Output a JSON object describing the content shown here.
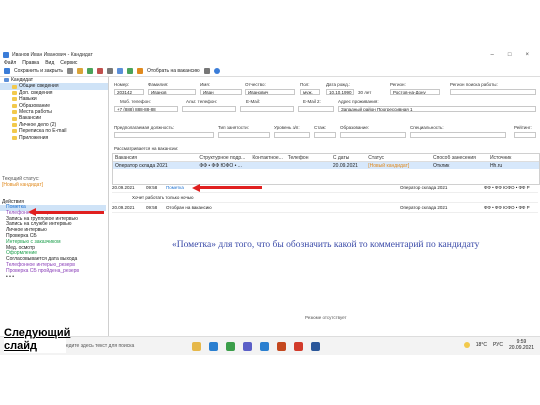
{
  "window": {
    "title": "Иванов Иван Иванович - Кандидат",
    "controls": [
      "–",
      "□",
      "×"
    ]
  },
  "menu": [
    "Файл",
    "Правка",
    "Вид",
    "Сервис"
  ],
  "toolbar": {
    "save_close": "Сохранить и закрыть",
    "send_vacancy": "Отобрать на вакансию"
  },
  "tree": {
    "root": "Кандидат",
    "items": [
      "Общие сведения",
      "Доп. сведения",
      "Навыки",
      "Образование",
      "Места работы",
      "Вакансии",
      "Личное дело (2)",
      "Переписка по E-mail",
      "Приложения"
    ]
  },
  "status": {
    "label": "Текущий статус:",
    "value": "[Новый кандидат]"
  },
  "actions": {
    "label": "Действия",
    "items": [
      {
        "text": "Пометка",
        "color": "#1a6fd0"
      },
      {
        "text": "Телефонное интервью",
        "color": "#8a3fb8"
      },
      {
        "text": "Запись на групповое интервью",
        "color": "#222222"
      },
      {
        "text": "Запись на службе интервью",
        "color": "#222222"
      },
      {
        "text": "Личное интервью",
        "color": "#222222"
      },
      {
        "text": "Проверка СБ",
        "color": "#222222"
      },
      {
        "text": "Интервью с заказчиком",
        "color": "#1a9e4a"
      },
      {
        "text": "Мед. осмотр",
        "color": "#222222"
      },
      {
        "text": "Оформление",
        "color": "#1a9e4a"
      },
      {
        "text": "Согласовывается дата выхода",
        "color": "#222222"
      },
      {
        "text": "Телефонное интерью_резерв",
        "color": "#8a3fb8"
      },
      {
        "text": "Проверка СБ пройдена_резерв",
        "color": "#8a3fb8"
      },
      {
        "text": "• • •",
        "color": "#222222"
      }
    ]
  },
  "source": {
    "method_label": "Способ занесения: Отклик",
    "source_label": "Источник: Hh.ru"
  },
  "form": {
    "number_label": "Номер:",
    "number": "203142",
    "last_label": "Фамилия:",
    "last": "Иванов",
    "first_label": "Имя:",
    "first": "Иван",
    "middle_label": "Отчество:",
    "middle": "Иванович",
    "sex_label": "Пол:",
    "sex": "муж.",
    "dob_label": "Дата рожд.:",
    "dob": "10.10.1990",
    "age": "30 лет",
    "region_label": "Регион:",
    "region": "Ростов-на-Дону",
    "job_region_label": "Регион поиска работы:",
    "mobile_label": "Моб. телефон:",
    "mobile": "+7 (888) 888-88-88",
    "alt_phone_label": "Альт. телефон:",
    "email_label": "E-Mail:",
    "email2_label": "E-Mail 2:",
    "address_label": "Адрес проживания:",
    "address": "Западный район Прогрессивная 1",
    "position_label": "Предполагаемая должность:",
    "employment_label": "Тип занятости:",
    "level_label": "Уровень з/п:",
    "experience_label": "Стаж:",
    "education_label": "Образование:",
    "specialty_label": "Специальность:",
    "rating_label": "Рейтинг:"
  },
  "vacancies": {
    "heading": "Рассматривается на вакансии:",
    "columns": [
      "Вакансия",
      "Структурное подр...",
      "Контактное...",
      "Телефон",
      "С даты",
      "Статус",
      "Способ занесения",
      "Источник"
    ],
    "rows": [
      [
        "Оператор склада 2021",
        "ФФ • ФФ ЮФО • ...",
        "",
        "",
        "20.09.2021",
        "[Новый кандидат]",
        "Отклик",
        "Hh.ru"
      ]
    ]
  },
  "timeline": [
    {
      "date": "20.09.2021",
      "time": "09:58",
      "type": "Пометка",
      "vacancy": "Оператор склада 2021",
      "dept": "ФФ • ФФ ЮФО • ФФ Р"
    },
    {
      "date": "",
      "time": "",
      "type": "Хочет работать только ночью",
      "vacancy": "",
      "dept": ""
    },
    {
      "date": "20.09.2021",
      "time": "09:58",
      "type": "Отобран на вакансию",
      "vacancy": "Оператор склада 2021",
      "dept": "ФФ • ФФ ЮФО • ФФ Р"
    }
  ],
  "annotation": "«Пометка» для того, что бы обозначить какой то комментарий по кандидату",
  "resume_missing": "Резюме отсутствует",
  "slide_label": "Следующий слайд",
  "taskbar": {
    "search_placeholder": "Введите здесь текст для поиска",
    "temperature": "18°C",
    "lang": "РУС",
    "time": "9:59",
    "date": "20.09.2021"
  },
  "colors": {
    "annotation": "#3a4aa8",
    "arrow": "#e02020",
    "status_orange": "#e08a1e",
    "selection": "#cfe3f7"
  }
}
